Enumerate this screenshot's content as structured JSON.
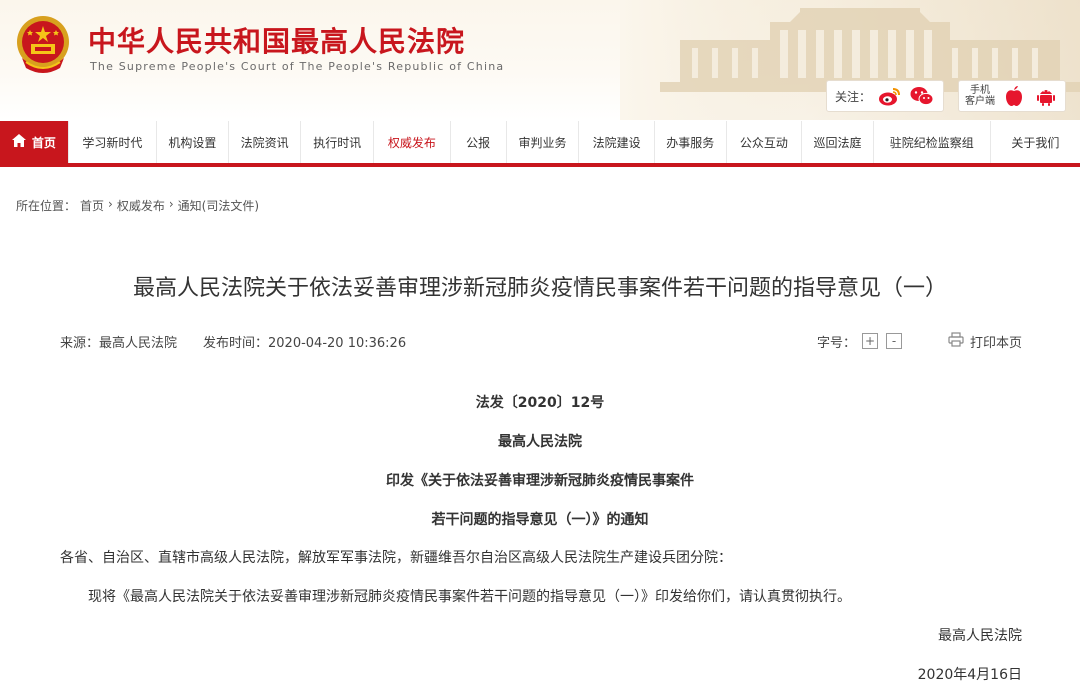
{
  "header": {
    "site_title": "中华人民共和国最高人民法院",
    "site_subtitle": "The Supreme People's Court of The People's Republic of China",
    "follow_label": "关注：",
    "mobile_label_1": "手机",
    "mobile_label_2": "客户端",
    "icons": [
      "weibo-icon",
      "wechat-icon",
      "apple-icon",
      "android-icon"
    ]
  },
  "nav": {
    "items": [
      {
        "label": "首页"
      },
      {
        "label": "学习新时代"
      },
      {
        "label": "机构设置"
      },
      {
        "label": "法院资讯"
      },
      {
        "label": "执行时讯"
      },
      {
        "label": "权威发布"
      },
      {
        "label": "公报"
      },
      {
        "label": "审判业务"
      },
      {
        "label": "法院建设"
      },
      {
        "label": "办事服务"
      },
      {
        "label": "公众互动"
      },
      {
        "label": "巡回法庭"
      },
      {
        "label": "驻院纪检监察组"
      },
      {
        "label": "关于我们"
      }
    ],
    "active_index": 5
  },
  "breadcrumb": {
    "prefix": "所在位置：",
    "items": [
      "首页",
      "权威发布",
      "通知(司法文件)"
    ],
    "separator": "›"
  },
  "article": {
    "title": "最高人民法院关于依法妥善审理涉新冠肺炎疫情民事案件若干问题的指导意见（一）",
    "source": "来源：最高人民法院",
    "publish_time": "发布时间：2020-04-20 10:36:26",
    "font_size_label": "字号：",
    "font_plus": "+",
    "font_minus": "-",
    "print_label": "打印本页",
    "doc_number": "法发〔2020〕12号",
    "issuer": "最高人民法院",
    "notice_line_1": "印发《关于依法妥善审理涉新冠肺炎疫情民事案件",
    "notice_line_2": "若干问题的指导意见（一）》的通知",
    "addressee": "各省、自治区、直辖市高级人民法院，解放军军事法院，新疆维吾尔自治区高级人民法院生产建设兵团分院：",
    "body": "现将《最高人民法院关于依法妥善审理涉新冠肺炎疫情民事案件若干问题的指导意见（一）》印发给你们，请认真贯彻执行。",
    "signature": "最高人民法院",
    "date": "2020年4月16日"
  },
  "colors": {
    "brand_red": "#c8161d",
    "header_bg": "#fbf6ec"
  }
}
